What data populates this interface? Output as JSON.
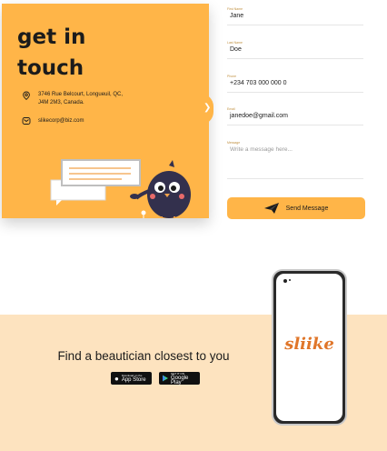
{
  "contact": {
    "title": "get in touch",
    "address": "3746 Rue Belcourt, Longueuil, QC, J4M 2M3, Canada.",
    "email": "slikecorp@biz.com"
  },
  "form": {
    "first_name": {
      "label": "First Name",
      "value": "Jane"
    },
    "last_name": {
      "label": "Last Name",
      "value": "Doe"
    },
    "phone": {
      "label": "Phone",
      "value": "+234 703 000 000 0"
    },
    "email": {
      "label": "Email",
      "value": "janedoe@gmail.com"
    },
    "message": {
      "label": "Message",
      "placeholder": "Write a message here..."
    },
    "send_label": "Send Message"
  },
  "promo": {
    "headline": "Find a beautician closest to you",
    "app_store": {
      "small": "Download on the",
      "big": "App Store"
    },
    "google_play": {
      "small": "GET IT ON",
      "big": "Google Play"
    },
    "logo_text": "sliike"
  },
  "colors": {
    "accent": "#ffb548",
    "band": "#fde3bf",
    "logo": "#e0762a"
  },
  "icons": [
    "location-pin-icon",
    "email-icon",
    "chevron-right-icon",
    "paper-plane-icon",
    "apple-icon",
    "google-play-icon"
  ]
}
